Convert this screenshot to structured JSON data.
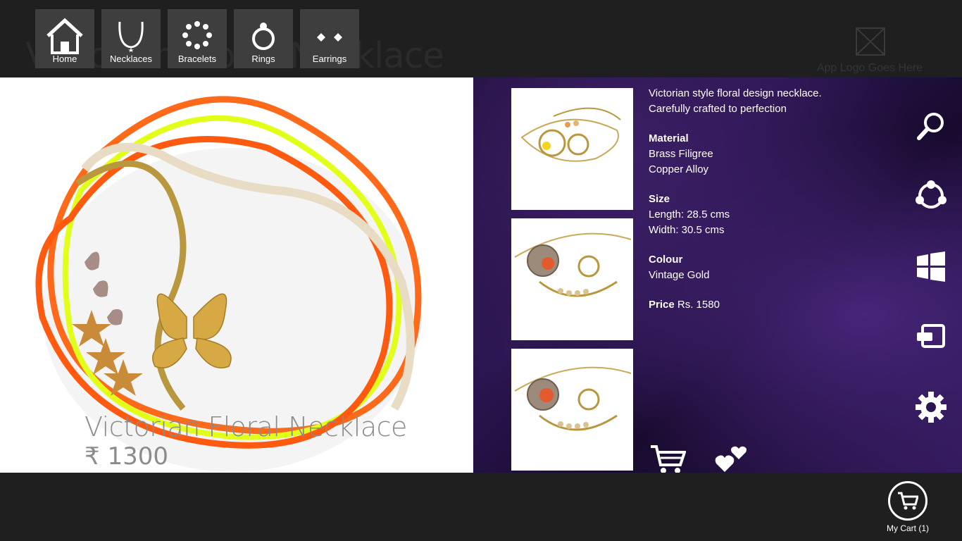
{
  "page": {
    "title_ghost": "Victorian Floral Necklace",
    "app_logo_text": "App Logo Goes Here"
  },
  "nav": {
    "items": [
      {
        "label": "Home",
        "icon": "home-icon"
      },
      {
        "label": "Necklaces",
        "icon": "necklace-icon"
      },
      {
        "label": "Bracelets",
        "icon": "bracelet-icon"
      },
      {
        "label": "Rings",
        "icon": "ring-icon"
      },
      {
        "label": "Earrings",
        "icon": "earrings-icon"
      }
    ]
  },
  "hero": {
    "name": "Victorian Floral Necklace",
    "price": "₹ 1300"
  },
  "detail": {
    "description_line1": "Victorian style floral design necklace.",
    "description_line2": "Carefully crafted to perfection",
    "material_label": "Material",
    "material_values": [
      "Brass Filigree",
      "Copper Alloy"
    ],
    "size_label": "Size",
    "size_values": [
      "Length: 28.5 cms",
      "Width: 30.5 cms"
    ],
    "colour_label": "Colour",
    "colour_value": "Vintage Gold",
    "price_label": "Price",
    "price_value": "Rs. 1580"
  },
  "charms": [
    "search-icon",
    "share-icon",
    "start-icon",
    "devices-icon",
    "settings-icon"
  ],
  "actions": [
    "add-to-cart-icon",
    "wishlist-icon"
  ],
  "bottom": {
    "cart_label": "My Cart (1)"
  },
  "colors": {
    "panel_purple": "#2a1550",
    "tile_gray": "#3e3e3e",
    "bar_dark": "#1f1f1f"
  }
}
